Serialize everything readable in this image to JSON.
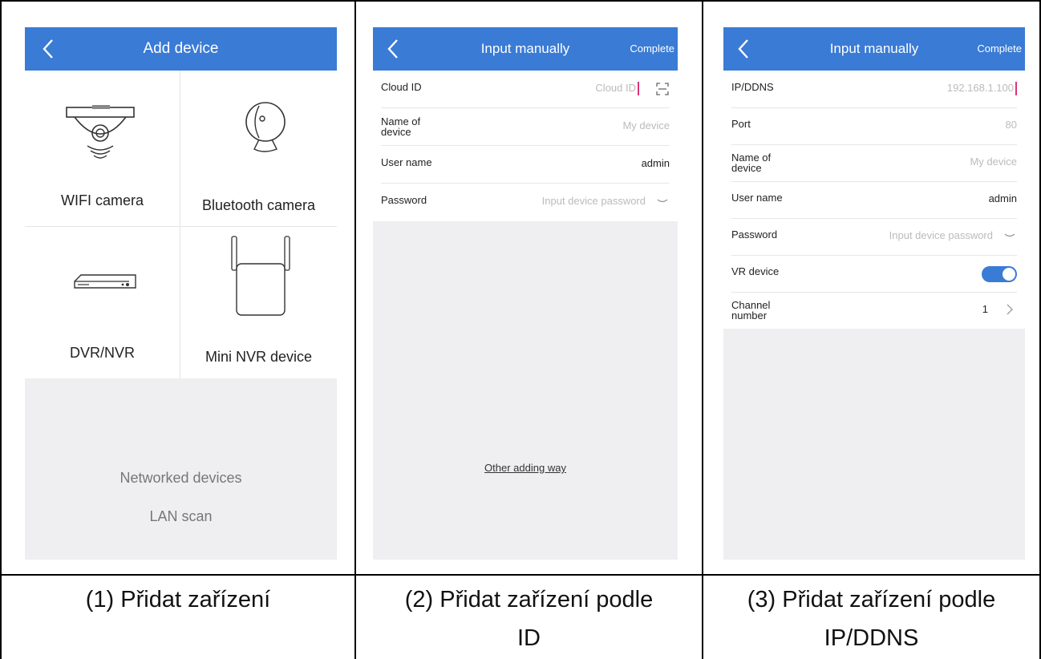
{
  "panel1": {
    "nav_title": "Add device",
    "tiles": [
      {
        "label": "WIFI camera",
        "icon": "wifi-camera-icon"
      },
      {
        "label": "Bluetooth camera",
        "icon": "bluetooth-camera-icon"
      },
      {
        "label": "DVR/NVR",
        "icon": "dvr-nvr-icon"
      },
      {
        "label": "Mini NVR device",
        "icon": "mini-nvr-icon"
      }
    ],
    "networked_devices": "Networked devices",
    "lan_scan": "LAN scan",
    "caption": "(1) Přidat zařízení"
  },
  "panel2": {
    "nav_title": "Input manually",
    "complete": "Complete",
    "rows": [
      {
        "label": "Cloud ID",
        "value": "Cloud ID"
      },
      {
        "label": "Name of device",
        "value": "My device"
      },
      {
        "label": "User name",
        "value": "admin"
      },
      {
        "label": "Password",
        "value": "Input device password"
      }
    ],
    "other_link": "Other adding way",
    "caption_line1": "(2) Přidat zařízení podle",
    "caption_line2": "ID"
  },
  "panel3": {
    "nav_title": "Input manually",
    "complete": "Complete",
    "rows": [
      {
        "label": "IP/DDNS",
        "value": "192.168.1.100"
      },
      {
        "label": "Port",
        "value": "80"
      },
      {
        "label": "Name of device",
        "value": "My device"
      },
      {
        "label": "User name",
        "value": "admin"
      },
      {
        "label": "Password",
        "value": "Input device password"
      },
      {
        "label": "VR device",
        "value": ""
      },
      {
        "label": "Channel number",
        "value": "1"
      }
    ],
    "caption_line1": "(3) Přidat zařízení podle",
    "caption_line2": "IP/DDNS"
  },
  "colors": {
    "accent": "#3a7bd5",
    "caret": "#e0317a",
    "background": "#efeff1"
  }
}
